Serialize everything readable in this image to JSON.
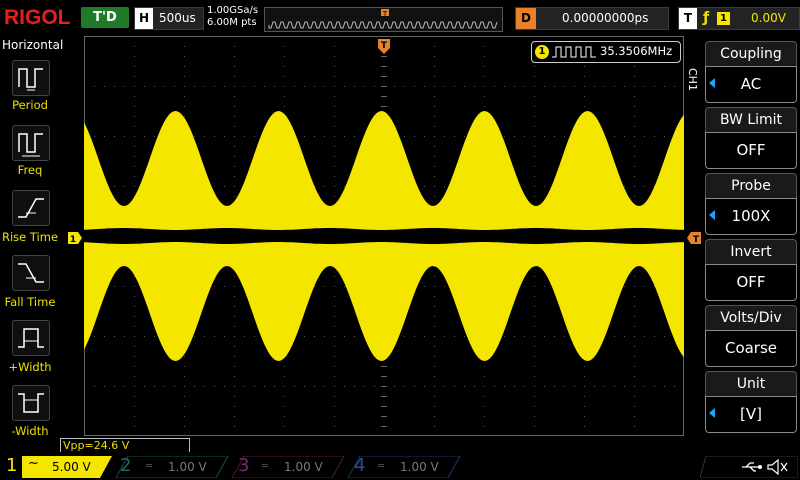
{
  "brand": "RIGOL",
  "run_status": "T'D",
  "horizontal": {
    "label": "H",
    "timebase": "500us"
  },
  "sample": {
    "rate": "1.00GSa/s",
    "points": "6.00M pts"
  },
  "delay": {
    "label": "D",
    "value": "0.00000000ps"
  },
  "trigger": {
    "label": "T",
    "edge": "ƒ",
    "source": "1",
    "level": "0.00V"
  },
  "left_menu": {
    "title": "Horizontal",
    "items": [
      {
        "label": "Period"
      },
      {
        "label": "Freq"
      },
      {
        "label": "Rise Time"
      },
      {
        "label": "Fall Time"
      },
      {
        "label": "+Width"
      },
      {
        "label": "-Width"
      }
    ]
  },
  "measurement": {
    "channel": "1",
    "value": "35.3506MHz"
  },
  "right_menu": {
    "channel": "CH1",
    "items": [
      {
        "title": "Coupling",
        "value": "AC"
      },
      {
        "title": "BW Limit",
        "value": "OFF"
      },
      {
        "title": "Probe",
        "value": "100X"
      },
      {
        "title": "Invert",
        "value": "OFF"
      },
      {
        "title": "Volts/Div",
        "value": "Coarse"
      },
      {
        "title": "Unit",
        "value": "[V]"
      }
    ]
  },
  "vpp": "Vpp=24.6 V",
  "channels": [
    {
      "num": "1",
      "scale": "5.00 V",
      "color": "#f5e600"
    },
    {
      "num": "2",
      "scale": "1.00 V",
      "color": "#1fb5a6"
    },
    {
      "num": "3",
      "scale": "1.00 V",
      "color": "#d33aa8"
    },
    {
      "num": "4",
      "scale": "1.00 V",
      "color": "#2a6fd6"
    }
  ],
  "colors": {
    "trace": "#f5e600",
    "grid": "#4a4a4a",
    "accent": "#e8812a",
    "menu_arrow": "#1ea3ff"
  }
}
